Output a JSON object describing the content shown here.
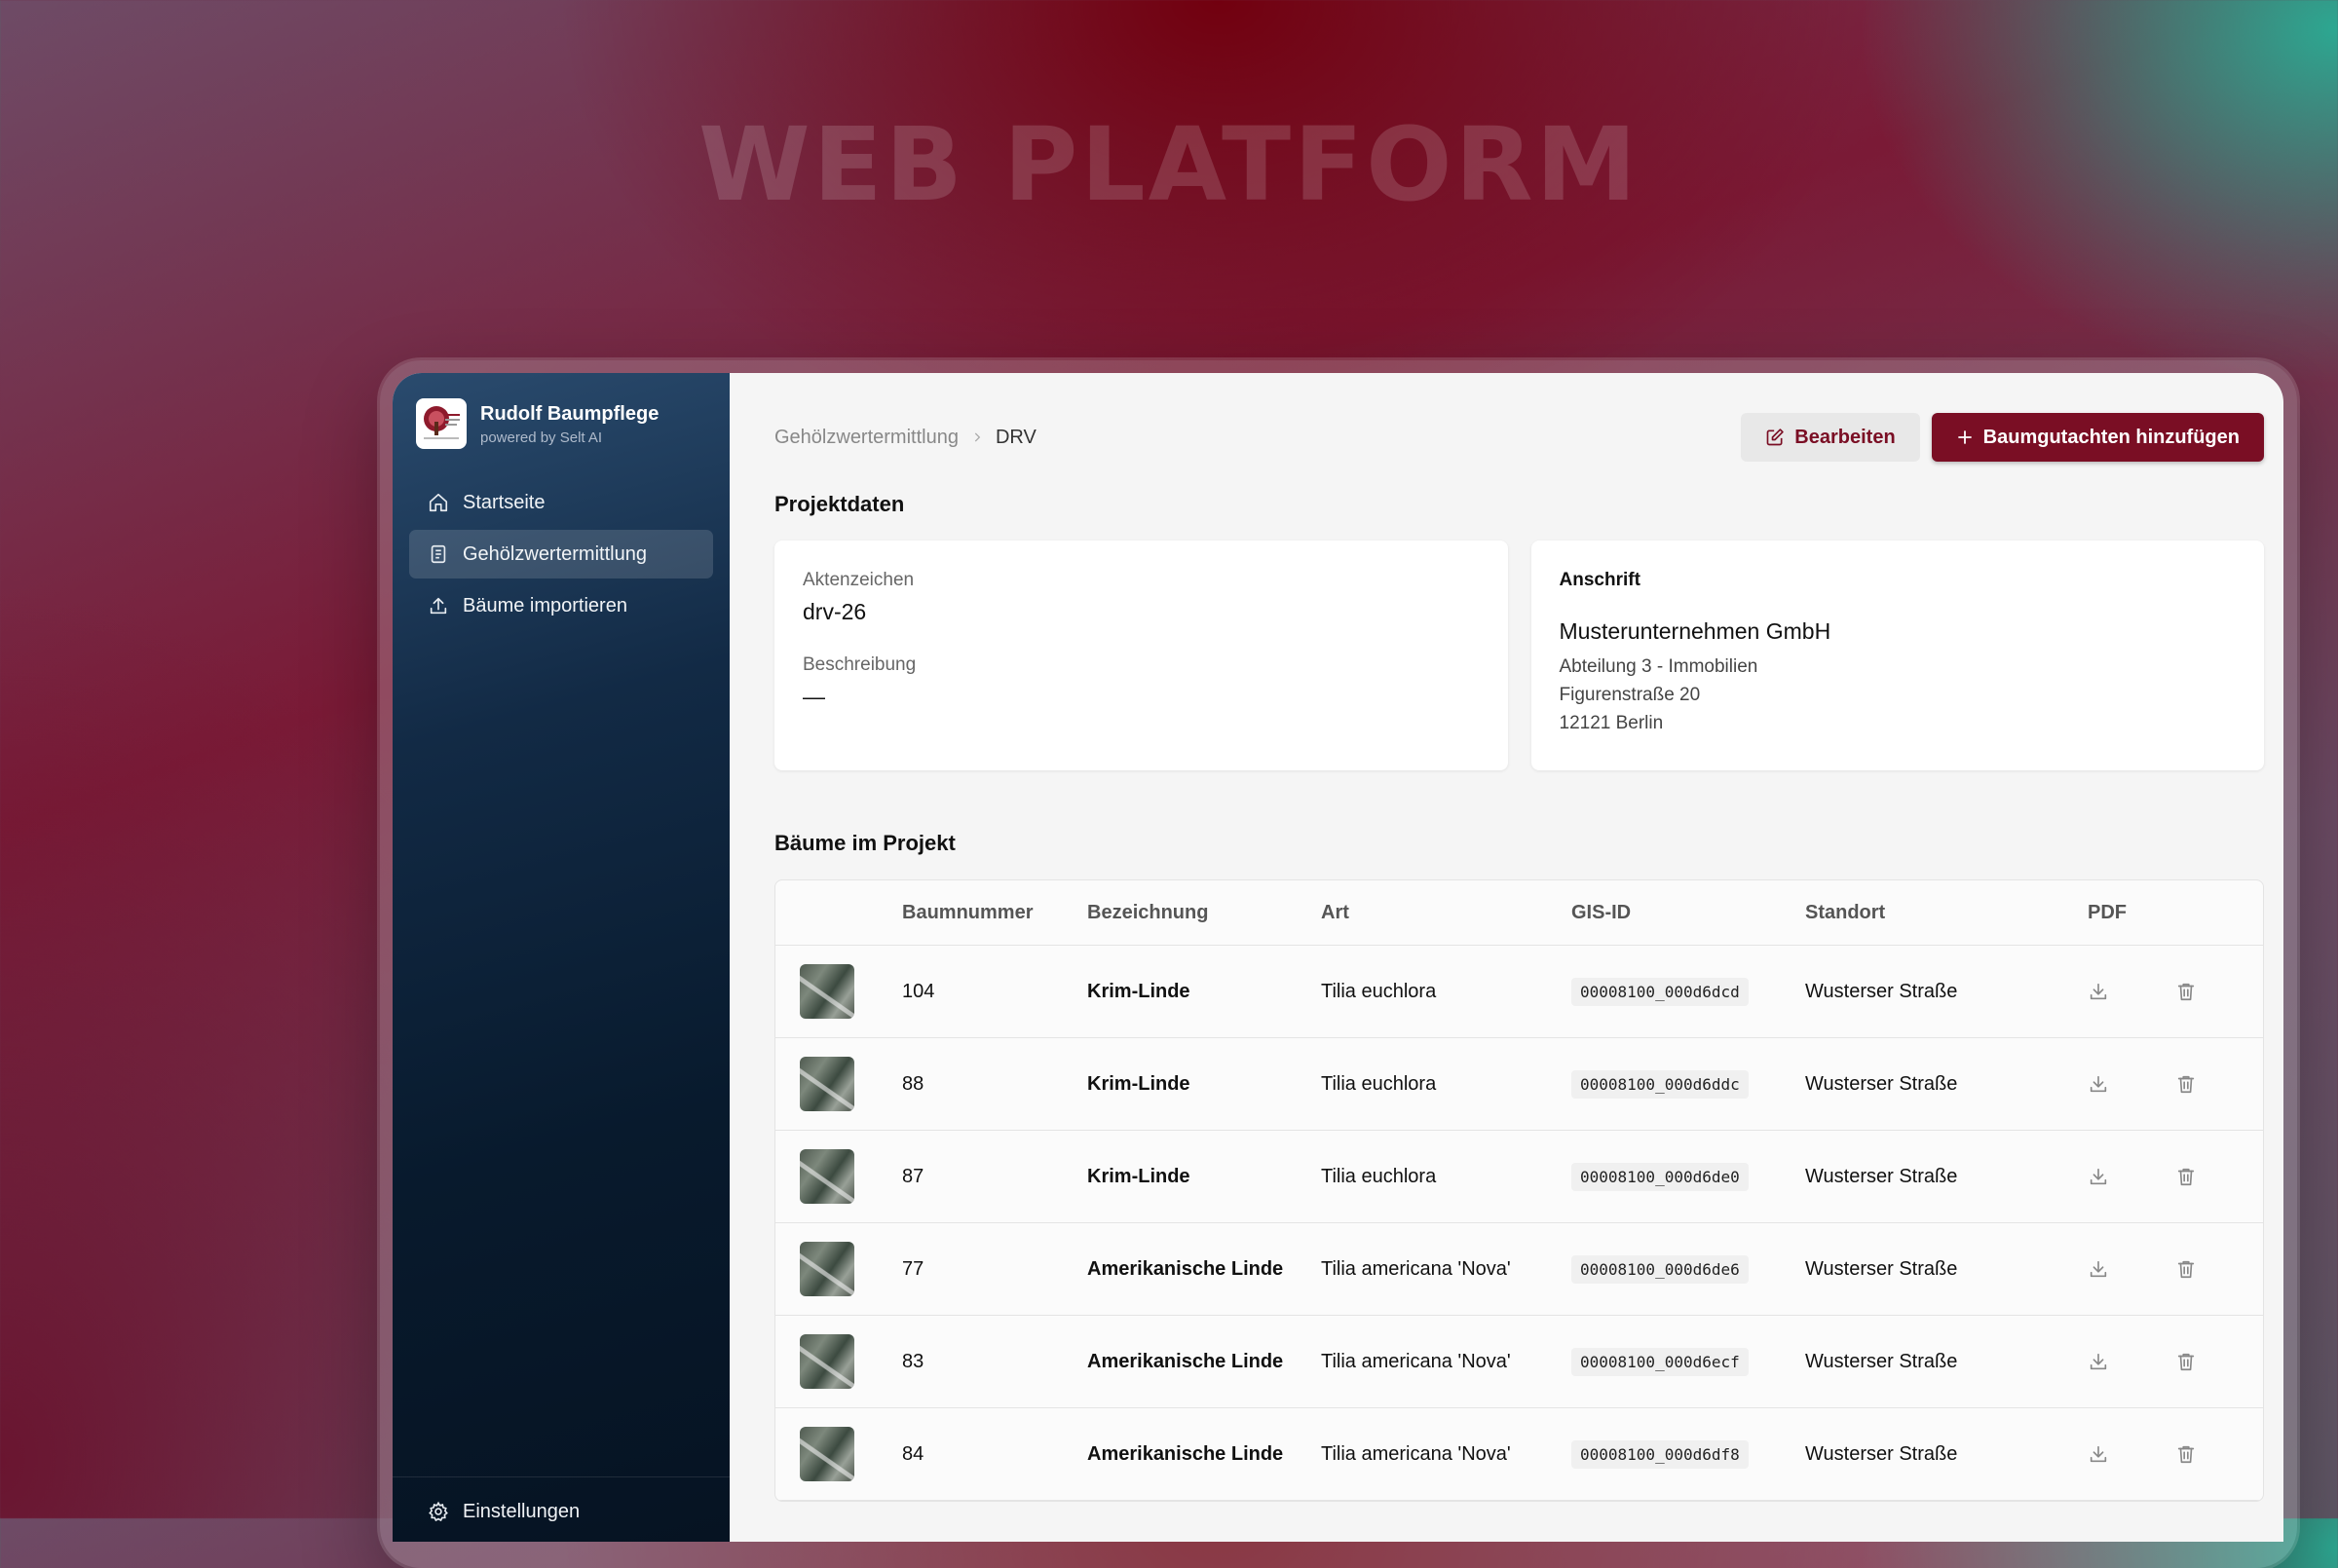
{
  "hero": {
    "title": "WEB PLATFORM"
  },
  "brand": {
    "name": "Rudolf Baumpflege",
    "sub": "powered by Selt AI",
    "logo_icon": "tree-logo-icon"
  },
  "sidebar": {
    "items": [
      {
        "label": "Startseite",
        "icon": "home-icon",
        "active": false
      },
      {
        "label": "Gehölzwertermittlung",
        "icon": "clipboard-icon",
        "active": true
      },
      {
        "label": "Bäume importieren",
        "icon": "upload-icon",
        "active": false
      }
    ],
    "footer": {
      "label": "Einstellungen",
      "icon": "gear-icon"
    }
  },
  "breadcrumb": {
    "parent": "Gehölzwertermittlung",
    "current": "DRV"
  },
  "toolbar": {
    "edit_label": "Bearbeiten",
    "add_label": "Baumgutachten hinzufügen"
  },
  "project": {
    "title": "Projektdaten",
    "aktenzeichen_label": "Aktenzeichen",
    "aktenzeichen": "drv-26",
    "beschreibung_label": "Beschreibung",
    "beschreibung": "—",
    "address": {
      "title": "Anschrift",
      "company": "Musterunternehmen GmbH",
      "line1": "Abteilung 3 - Immobilien",
      "line2": "Figurenstraße 20",
      "line3": "12121 Berlin"
    }
  },
  "trees": {
    "title": "Bäume im Projekt",
    "columns": [
      "Baumnummer",
      "Bezeichnung",
      "Art",
      "GIS-ID",
      "Standort",
      "PDF"
    ],
    "rows": [
      {
        "num": "104",
        "bez": "Krim-Linde",
        "art": "Tilia euchlora",
        "gis": "00008100_000d6dcd",
        "std": "Wusterser Straße"
      },
      {
        "num": "88",
        "bez": "Krim-Linde",
        "art": "Tilia euchlora",
        "gis": "00008100_000d6ddc",
        "std": "Wusterser Straße"
      },
      {
        "num": "87",
        "bez": "Krim-Linde",
        "art": "Tilia euchlora",
        "gis": "00008100_000d6de0",
        "std": "Wusterser Straße"
      },
      {
        "num": "77",
        "bez": "Amerikanische Linde",
        "art": "Tilia americana 'Nova'",
        "gis": "00008100_000d6de6",
        "std": "Wusterser Straße"
      },
      {
        "num": "83",
        "bez": "Amerikanische Linde",
        "art": "Tilia americana 'Nova'",
        "gis": "00008100_000d6ecf",
        "std": "Wusterser Straße"
      },
      {
        "num": "84",
        "bez": "Amerikanische Linde",
        "art": "Tilia americana 'Nova'",
        "gis": "00008100_000d6df8",
        "std": "Wusterser Straße"
      }
    ]
  },
  "colors": {
    "accent": "#7a0e24",
    "sidebar": "#0b1f35"
  }
}
